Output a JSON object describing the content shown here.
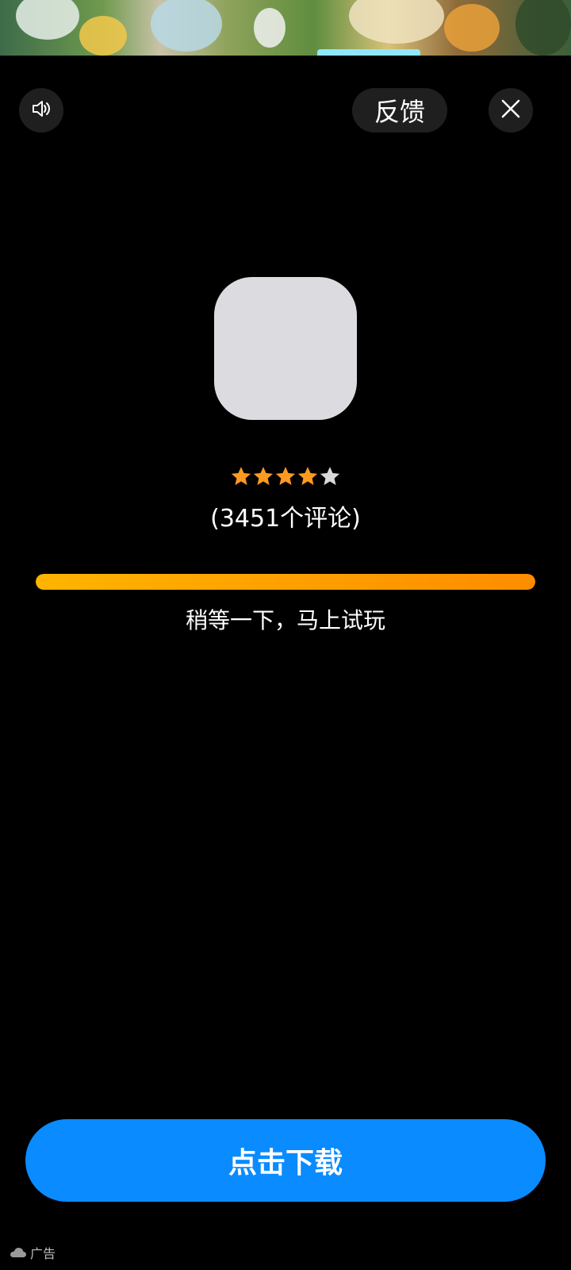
{
  "header": {
    "feedback_label": "反馈"
  },
  "icons": {
    "volume": "speaker-icon",
    "close": "close-icon",
    "ad": "cloud-icon"
  },
  "app": {
    "rating": 4,
    "rating_max": 5,
    "reviews_text": "(3451个评论)"
  },
  "progress": {
    "percent": 100,
    "message": "稍等一下，马上试玩"
  },
  "cta": {
    "download_label": "点击下载"
  },
  "footer": {
    "ad_label": "广告"
  },
  "colors": {
    "background": "#000000",
    "star_filled": "#ff9a1f",
    "star_empty": "#d9d9d9",
    "progress_start": "#ffb400",
    "progress_end": "#ff8c00",
    "download_button": "#0a8bff"
  }
}
